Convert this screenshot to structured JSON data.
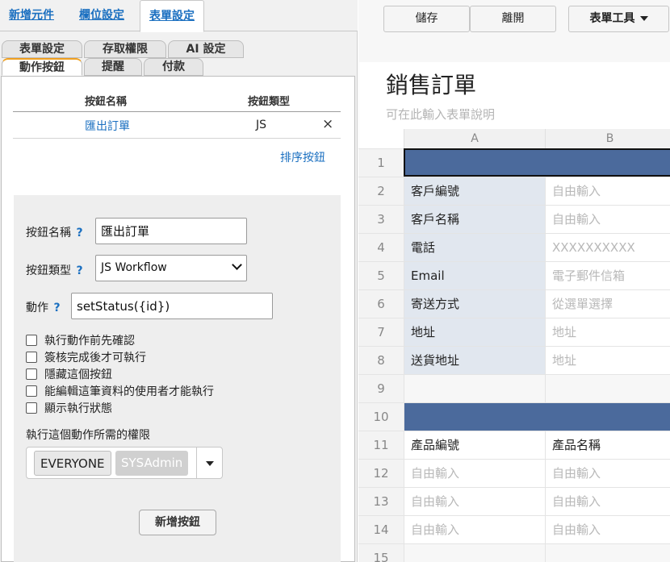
{
  "top_tabs": [
    {
      "label": "新增元件"
    },
    {
      "label": "欄位設定"
    },
    {
      "label": "表單設定"
    }
  ],
  "sub_tabs": {
    "row1": [
      {
        "label": "表單設定"
      },
      {
        "label": "存取權限"
      },
      {
        "label": "AI 設定"
      }
    ],
    "row2": [
      {
        "label": "動作按鈕"
      },
      {
        "label": "提醒"
      },
      {
        "label": "付款"
      }
    ]
  },
  "buttons_table": {
    "col_name": "按鈕名稱",
    "col_type": "按鈕類型",
    "rows": [
      {
        "name": "匯出訂單",
        "type": "JS",
        "delete": "×"
      }
    ],
    "sort_link": "排序按鈕"
  },
  "detail": {
    "name_label": "按鈕名稱",
    "name_value": "匯出訂單",
    "type_label": "按鈕類型",
    "type_value": "JS Workflow",
    "action_label": "動作",
    "action_value": "setStatus({id})",
    "help": "?",
    "checkboxes": [
      {
        "label": "執行動作前先確認",
        "checked": false
      },
      {
        "label": "簽核完成後才可執行",
        "checked": false
      },
      {
        "label": "隱藏這個按鈕",
        "checked": false
      },
      {
        "label": "能編輯這筆資料的使用者才能執行",
        "checked": false
      },
      {
        "label": "顯示執行狀態",
        "checked": false
      }
    ],
    "perm_label": "執行這個動作所需的權限",
    "perm_chips": [
      "EVERYONE",
      "SYSAdmin"
    ],
    "add_button": "新增按鈕"
  },
  "toolbar": {
    "save": "儲存",
    "leave": "離開",
    "tools": "表單工具"
  },
  "form": {
    "title": "銷售訂單",
    "description": "可在此輸入表單說明"
  },
  "grid": {
    "columns": [
      "A",
      "B"
    ],
    "rows": [
      {
        "num": "1",
        "a": "",
        "b": "",
        "kind": "header"
      },
      {
        "num": "2",
        "a": "客戶編號",
        "b": "自由輸入",
        "kind": "field"
      },
      {
        "num": "3",
        "a": "客戶名稱",
        "b": "自由輸入",
        "kind": "field"
      },
      {
        "num": "4",
        "a": "電話",
        "b": "XXXXXXXXXX",
        "kind": "field"
      },
      {
        "num": "5",
        "a": "Email",
        "b": "電子郵件信箱",
        "kind": "field"
      },
      {
        "num": "6",
        "a": "寄送方式",
        "b": "從選單選擇",
        "kind": "field"
      },
      {
        "num": "7",
        "a": "地址",
        "b": "地址",
        "kind": "field"
      },
      {
        "num": "8",
        "a": "送貨地址",
        "b": "地址",
        "kind": "field"
      },
      {
        "num": "9",
        "a": "",
        "b": "",
        "kind": "blank"
      },
      {
        "num": "10",
        "a": "",
        "b": "",
        "kind": "header"
      },
      {
        "num": "11",
        "a": "產品編號",
        "b": "產品名稱",
        "kind": "colhead"
      },
      {
        "num": "12",
        "a": "自由輸入",
        "b": "自由輸入",
        "kind": "inputs"
      },
      {
        "num": "13",
        "a": "自由輸入",
        "b": "自由輸入",
        "kind": "inputs"
      },
      {
        "num": "14",
        "a": "自由輸入",
        "b": "自由輸入",
        "kind": "inputs"
      },
      {
        "num": "15",
        "a": "",
        "b": "",
        "kind": "blank"
      }
    ]
  },
  "colors": {
    "link": "#1a6fc0",
    "section_header": "#4b6a9c",
    "label_cell": "#e1e7ef",
    "active_tab_accent": "#f0a020"
  }
}
